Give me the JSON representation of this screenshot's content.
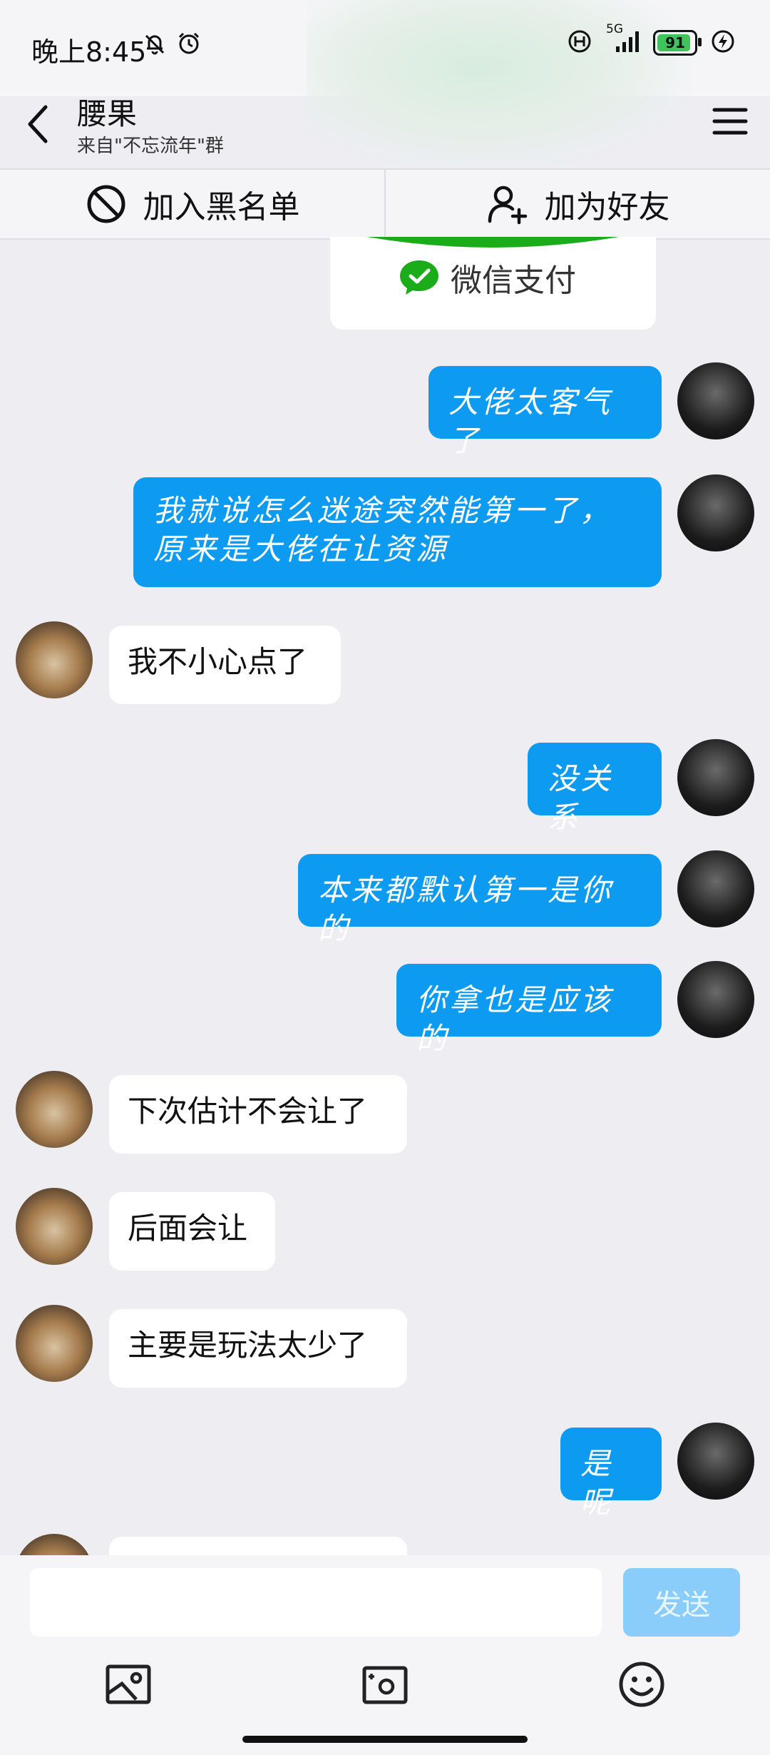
{
  "status_bar": {
    "time": "晚上8:45",
    "network": "5G",
    "battery": "91",
    "battery_level": 0.91
  },
  "header": {
    "title": "腰果",
    "subtitle": "来自\"不忘流年\"群"
  },
  "actions": {
    "blacklist": "加入黑名单",
    "add_friend": "加为好友"
  },
  "payment_card": {
    "label": "微信支付"
  },
  "messages": [
    {
      "from": "me",
      "text": "大佬太客气了"
    },
    {
      "from": "me",
      "text": "我就说怎么迷途突然能第一了，原来是大佬在让资源"
    },
    {
      "from": "other",
      "text": "我不小心点了"
    },
    {
      "from": "me",
      "text": "没关系"
    },
    {
      "from": "me",
      "text": "本来都默认第一是你的"
    },
    {
      "from": "me",
      "text": "你拿也是应该的"
    },
    {
      "from": "other",
      "text": "下次估计不会让了"
    },
    {
      "from": "other",
      "text": "后面会让"
    },
    {
      "from": "other",
      "text": "主要是玩法太少了"
    },
    {
      "from": "me",
      "text": "是呢"
    }
  ],
  "input": {
    "value": "",
    "send_label": "发送"
  },
  "toolbar": {
    "icons": [
      "image-icon",
      "camera-icon",
      "emoji-icon"
    ]
  },
  "colors": {
    "my_bubble": "#0d9bf2",
    "other_bubble": "#ffffff",
    "background": "#ededf2",
    "send_disabled": "#8bcdfa",
    "wechat_green": "#1aad19",
    "battery_green": "#3fc35a"
  }
}
